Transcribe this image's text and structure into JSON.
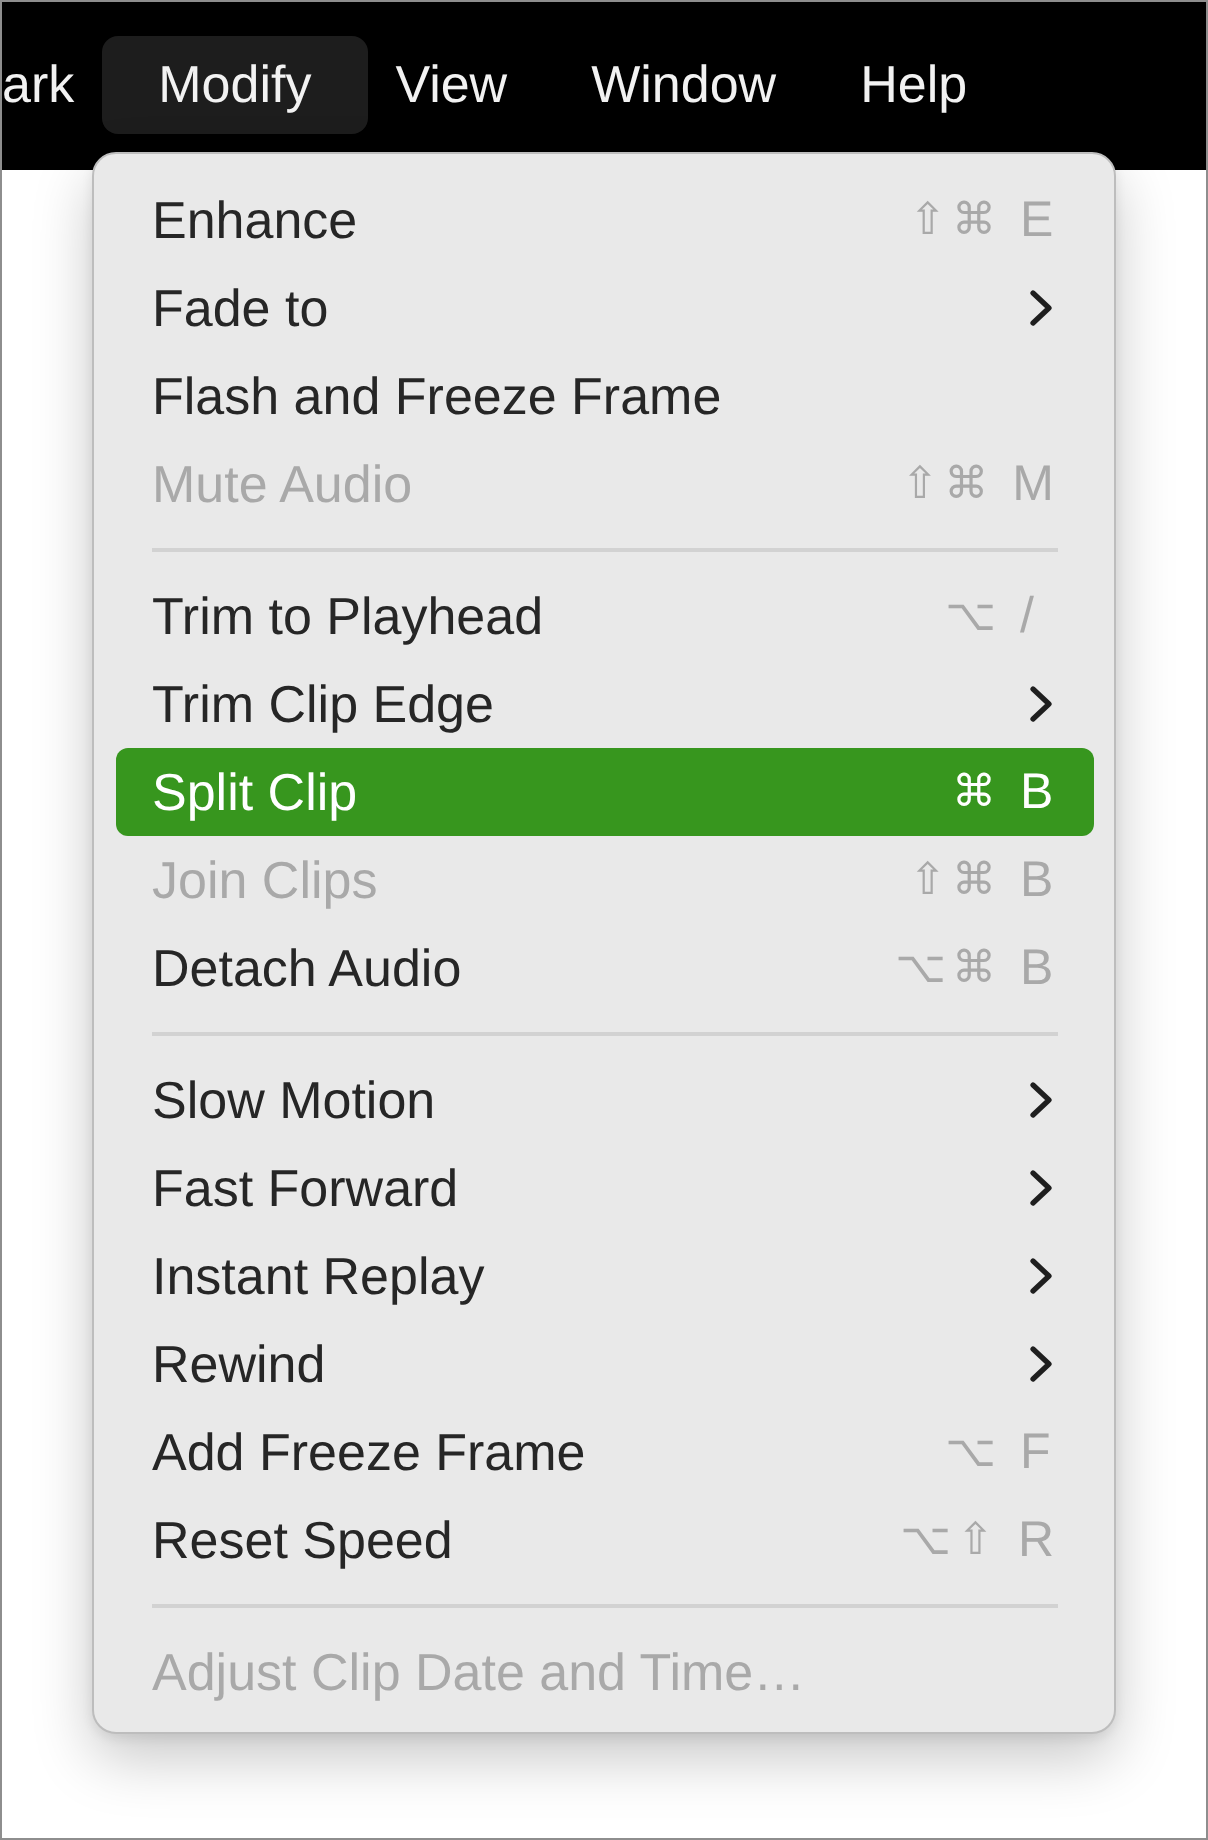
{
  "menu_bar": {
    "items": [
      {
        "label": "ark",
        "selected": false
      },
      {
        "label": "Modify",
        "selected": true
      },
      {
        "label": "View",
        "selected": false
      },
      {
        "label": "Window",
        "selected": false
      },
      {
        "label": "Help",
        "selected": false
      }
    ]
  },
  "menu": {
    "groups": [
      {
        "items": [
          {
            "label": "Enhance",
            "shortcut": {
              "modifiers": "⇧⌘",
              "key": "E"
            },
            "submenu": false,
            "disabled": false,
            "selected": false
          },
          {
            "label": "Fade to",
            "submenu": true,
            "disabled": false,
            "selected": false
          },
          {
            "label": "Flash and Freeze Frame",
            "submenu": false,
            "disabled": false,
            "selected": false
          },
          {
            "label": "Mute Audio",
            "shortcut": {
              "modifiers": "⇧⌘",
              "key": "M"
            },
            "submenu": false,
            "disabled": true,
            "selected": false
          }
        ]
      },
      {
        "items": [
          {
            "label": "Trim to Playhead",
            "shortcut": {
              "modifiers": "⌥",
              "key": "/"
            },
            "submenu": false,
            "disabled": false,
            "selected": false
          },
          {
            "label": "Trim Clip Edge",
            "submenu": true,
            "disabled": false,
            "selected": false
          },
          {
            "label": "Split Clip",
            "shortcut": {
              "modifiers": "⌘",
              "key": "B"
            },
            "submenu": false,
            "disabled": false,
            "selected": true
          },
          {
            "label": "Join Clips",
            "shortcut": {
              "modifiers": "⇧⌘",
              "key": "B"
            },
            "submenu": false,
            "disabled": true,
            "selected": false
          },
          {
            "label": "Detach Audio",
            "shortcut": {
              "modifiers": "⌥⌘",
              "key": "B"
            },
            "submenu": false,
            "disabled": false,
            "selected": false
          }
        ]
      },
      {
        "items": [
          {
            "label": "Slow Motion",
            "submenu": true,
            "disabled": false,
            "selected": false
          },
          {
            "label": "Fast Forward",
            "submenu": true,
            "disabled": false,
            "selected": false
          },
          {
            "label": "Instant Replay",
            "submenu": true,
            "disabled": false,
            "selected": false
          },
          {
            "label": "Rewind",
            "submenu": true,
            "disabled": false,
            "selected": false
          },
          {
            "label": "Add Freeze Frame",
            "shortcut": {
              "modifiers": "⌥",
              "key": "F"
            },
            "submenu": false,
            "disabled": false,
            "selected": false
          },
          {
            "label": "Reset Speed",
            "shortcut": {
              "modifiers": "⌥⇧",
              "key": "R"
            },
            "submenu": false,
            "disabled": false,
            "selected": false
          }
        ]
      },
      {
        "items": [
          {
            "label": "Adjust Clip Date and Time…",
            "submenu": false,
            "disabled": true,
            "selected": false
          }
        ]
      }
    ]
  }
}
